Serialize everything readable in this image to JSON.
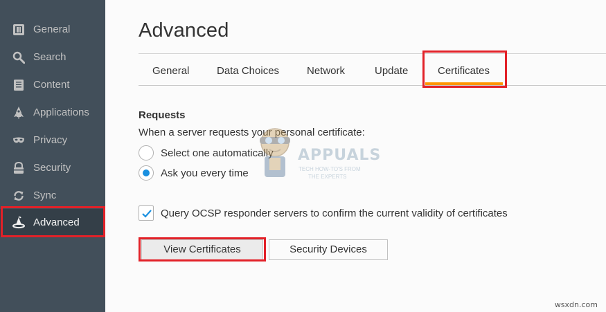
{
  "sidebar": {
    "items": [
      {
        "label": "General",
        "icon": "general-icon"
      },
      {
        "label": "Search",
        "icon": "search-icon"
      },
      {
        "label": "Content",
        "icon": "content-icon"
      },
      {
        "label": "Applications",
        "icon": "applications-icon"
      },
      {
        "label": "Privacy",
        "icon": "privacy-mask-icon"
      },
      {
        "label": "Security",
        "icon": "security-icon"
      },
      {
        "label": "Sync",
        "icon": "sync-icon"
      },
      {
        "label": "Advanced",
        "icon": "advanced-wizard-hat-icon",
        "selected": true
      }
    ]
  },
  "main": {
    "title": "Advanced",
    "tabs": [
      {
        "label": "General"
      },
      {
        "label": "Data Choices"
      },
      {
        "label": "Network"
      },
      {
        "label": "Update"
      },
      {
        "label": "Certificates",
        "selected": true
      }
    ],
    "requests": {
      "heading": "Requests",
      "description": "When a server requests your personal certificate:",
      "options": [
        {
          "label": "Select one automatically",
          "checked": false
        },
        {
          "label": "Ask you every time",
          "checked": true
        }
      ]
    },
    "ocsp": {
      "label": "Query OCSP responder servers to confirm the current validity of certificates",
      "checked": true
    },
    "buttons": {
      "view_certificates": "View Certificates",
      "security_devices": "Security Devices"
    }
  },
  "watermarks": {
    "brand": "APPUALS",
    "tagline_1": "TECH HOW-TO'S FROM",
    "tagline_2": "THE EXPERTS",
    "site": "wsxdn.com"
  },
  "colors": {
    "sidebar_bg": "#424f5a",
    "sidebar_selected_bg": "#343f48",
    "accent_orange": "#ff9500",
    "radio_blue": "#1a90e0",
    "highlight_red": "#e22128"
  }
}
